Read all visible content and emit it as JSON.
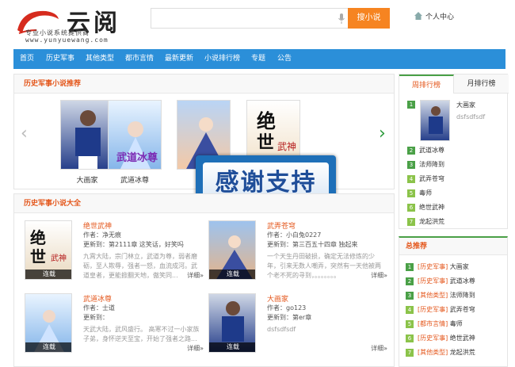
{
  "header": {
    "logo_title": "云阅",
    "logo_subtitle": "专业小说系统提供商",
    "logo_url": "www.yunyuewang.com",
    "search_placeholder": "",
    "search_button": "搜小说",
    "user_center": "个人中心"
  },
  "nav": [
    "首页",
    "历史军事",
    "其他类型",
    "都市言情",
    "最新更新",
    "小说排行榜",
    "专题",
    "公告"
  ],
  "featured": {
    "title": "历史军事小说推荐",
    "books": [
      "大画家",
      "武道冰尊",
      "武",
      "",
      "绝世武神"
    ]
  },
  "banner": "感谢支持",
  "library": {
    "title": "历史军事小说大全",
    "author_label": "作者：",
    "updated_label": "更新到：",
    "more_label": "详细",
    "status_label": "连载",
    "books": [
      {
        "title": "绝世武神",
        "author": "净无痕",
        "updated": "第2111章 这笑话，好笑吗",
        "desc": "九霄大陆，宗门林立，武道为尊，弱者磨砺，至人欺辱，强者一怒，血流成河。武道皇者，更能掀翻天地，傲笑同..."
      },
      {
        "title": "武弄苍穹",
        "author": "小白兔0227",
        "updated": "第三百五十四章 独起来",
        "desc": "一个天生丹田破损，确定无法修炼的少年，引来无数人嘲弄，突然有一天他被两个老不死的寻到，。。。。。。。"
      },
      {
        "title": "武道冰尊",
        "author": "士道",
        "updated": "",
        "desc": "天武大陆，武风盛行。 高寒不过一小家族子弟，身怀逆天至宝，开始了强者之路..."
      },
      {
        "title": "大画家",
        "author": "go123",
        "updated": "第er章",
        "desc": "dsfsdfsdf"
      }
    ]
  },
  "sidebar": {
    "tab_week": "周排行榜",
    "tab_month": "月排行榜",
    "top_book": {
      "rank": "1",
      "title": "大画家",
      "desc": "dsfsdfsdf"
    },
    "ranks": [
      {
        "rank": "2",
        "title": "武道冰尊"
      },
      {
        "rank": "3",
        "title": "法师降到"
      },
      {
        "rank": "4",
        "title": "武弄苍穹"
      },
      {
        "rank": "5",
        "title": "毒师"
      },
      {
        "rank": "6",
        "title": "绝世武神"
      },
      {
        "rank": "7",
        "title": "龙起洪荒"
      }
    ],
    "rec_title": "总推荐",
    "recs": [
      {
        "rank": "1",
        "cat": "[历史军事]",
        "title": "大画家"
      },
      {
        "rank": "2",
        "cat": "[历史军事]",
        "title": "武道冰尊"
      },
      {
        "rank": "3",
        "cat": "[其他类型]",
        "title": "法师降到"
      },
      {
        "rank": "4",
        "cat": "[历史军事]",
        "title": "武弄苍穹"
      },
      {
        "rank": "5",
        "cat": "[都市言情]",
        "title": "毒师"
      },
      {
        "rank": "6",
        "cat": "[历史军事]",
        "title": "绝世武神"
      },
      {
        "rank": "7",
        "cat": "[其他类型]",
        "title": "龙起洪荒"
      }
    ]
  },
  "colors": {
    "accent": "#f68421",
    "nav": "#2b8fd9",
    "title": "#e4571c",
    "rank": "#4aa047"
  }
}
